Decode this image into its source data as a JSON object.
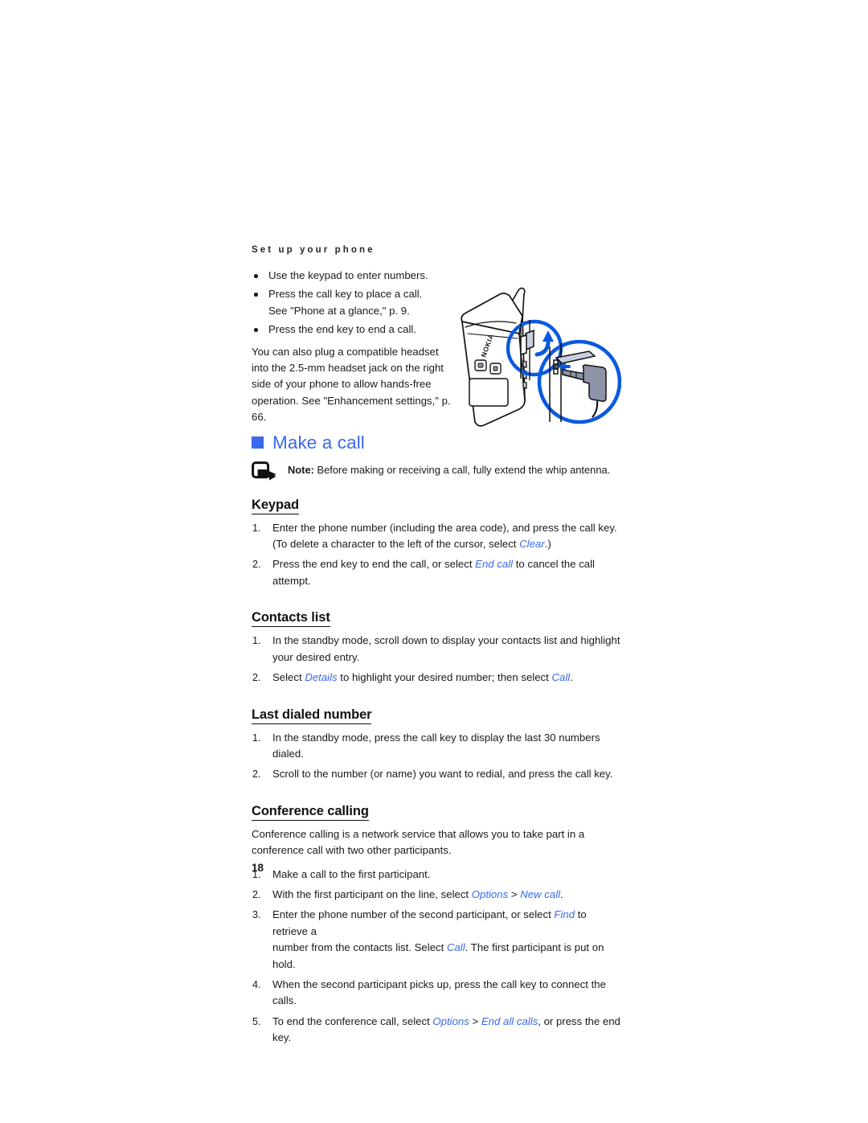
{
  "document": {
    "running_header": "Set up your phone",
    "page_number": "18",
    "accent_color": "#3a68ee",
    "text_color": "#1a1a1a"
  },
  "intro": {
    "bullets": [
      {
        "text": "Use the keypad to enter numbers.",
        "subline": ""
      },
      {
        "text": "Press the call key to place a call.",
        "subline": "See \"Phone at a glance,\" p. 9."
      },
      {
        "text": "Press the end key to end a call.",
        "subline": ""
      }
    ],
    "paragraph": "You can also plug a compatible headset into the 2.5-mm headset jack on the right side of your phone to allow hands-free operation. See \"Enhancement settings,\" p. 66."
  },
  "illustration": {
    "name": "phone-headset-jack-illustration",
    "brand_label": "NOKIA",
    "outline_color": "#111111",
    "callout_color": "#0a5ae0",
    "shade_color": "#c9cfe0"
  },
  "chapter": {
    "bullet_icon": "filled-square-icon",
    "title": "Make a call"
  },
  "note": {
    "icon": "note-arrow-icon",
    "label": "Note:",
    "text": " Before making or receiving a call, fully extend the whip antenna."
  },
  "sections": [
    {
      "id": "keypad",
      "heading": "Keypad",
      "steps": [
        {
          "parts": [
            {
              "t": "Enter the phone number (including the area code), and press the call key."
            }
          ],
          "subparts": [
            {
              "t": "(To delete a character to the left of the cursor, select "
            },
            {
              "t": "Clear",
              "style": "term"
            },
            {
              "t": ".)"
            }
          ]
        },
        {
          "parts": [
            {
              "t": "Press the end key to end the call, or select "
            },
            {
              "t": "End call",
              "style": "term"
            },
            {
              "t": " to cancel the call attempt."
            }
          ],
          "subparts": []
        }
      ]
    },
    {
      "id": "contacts-list",
      "heading": "Contacts list",
      "steps": [
        {
          "parts": [
            {
              "t": "In the standby mode, scroll down to display your contacts list and highlight"
            }
          ],
          "subparts": [
            {
              "t": "your desired entry."
            }
          ]
        },
        {
          "parts": [
            {
              "t": "Select "
            },
            {
              "t": "Details",
              "style": "term"
            },
            {
              "t": " to highlight your desired number; then select "
            },
            {
              "t": "Call",
              "style": "term"
            },
            {
              "t": "."
            }
          ],
          "subparts": []
        }
      ]
    },
    {
      "id": "last-dialed-number",
      "heading": "Last dialed number",
      "steps": [
        {
          "parts": [
            {
              "t": "In the standby mode, press the call key to display the last 30 numbers dialed."
            }
          ],
          "subparts": []
        },
        {
          "parts": [
            {
              "t": "Scroll to the number (or name) you want to redial, and press the call key."
            }
          ],
          "subparts": []
        }
      ]
    },
    {
      "id": "conference-calling",
      "heading": "Conference calling",
      "intro": "Conference calling is a network service that allows you to take part in a conference call with two other participants.",
      "steps": [
        {
          "parts": [
            {
              "t": "Make a call to the first participant."
            }
          ],
          "subparts": []
        },
        {
          "parts": [
            {
              "t": "With the first participant on the line, select "
            },
            {
              "t": "Options",
              "style": "term"
            },
            {
              "t": " > "
            },
            {
              "t": "New call",
              "style": "term"
            },
            {
              "t": "."
            }
          ],
          "subparts": []
        },
        {
          "parts": [
            {
              "t": "Enter the phone number of the second participant, or select "
            },
            {
              "t": "Find",
              "style": "term"
            },
            {
              "t": " to retrieve a"
            }
          ],
          "subparts": [
            {
              "t": "number from the contacts list. Select "
            },
            {
              "t": "Call",
              "style": "term"
            },
            {
              "t": ". The first participant is put on hold."
            }
          ]
        },
        {
          "parts": [
            {
              "t": "When the second participant picks up, press the call key to connect the calls."
            }
          ],
          "subparts": []
        },
        {
          "parts": [
            {
              "t": "To end the conference call, select "
            },
            {
              "t": "Options",
              "style": "term"
            },
            {
              "t": " > "
            },
            {
              "t": "End all calls",
              "style": "term"
            },
            {
              "t": ", or press the end key."
            }
          ],
          "subparts": []
        }
      ]
    }
  ]
}
